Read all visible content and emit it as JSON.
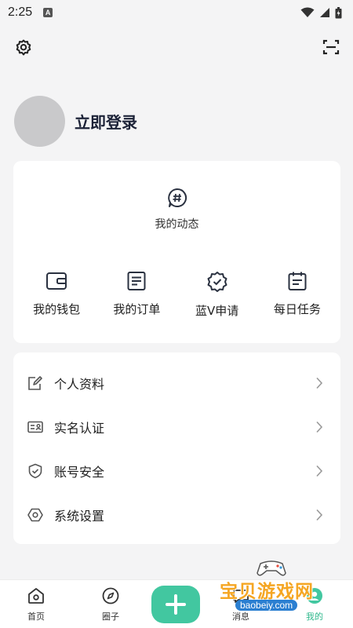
{
  "status_bar": {
    "time": "2:25",
    "badge": "A"
  },
  "profile": {
    "login_label": "立即登录"
  },
  "dynamic": {
    "label": "我的动态"
  },
  "quick_actions": [
    {
      "label": "我的钱包",
      "icon": "wallet-icon"
    },
    {
      "label": "我的订单",
      "icon": "order-list-icon"
    },
    {
      "label": "蓝V申请",
      "icon": "verified-badge-icon"
    },
    {
      "label": "每日任务",
      "icon": "calendar-task-icon"
    }
  ],
  "menu": [
    {
      "label": "个人资料",
      "icon": "edit-profile-icon"
    },
    {
      "label": "实名认证",
      "icon": "id-card-icon"
    },
    {
      "label": "账号安全",
      "icon": "shield-check-icon"
    },
    {
      "label": "系统设置",
      "icon": "settings-hex-icon"
    }
  ],
  "bottom_nav": [
    {
      "label": "首页",
      "icon": "home-icon"
    },
    {
      "label": "圈子",
      "icon": "compass-icon"
    },
    {
      "label": "消息",
      "icon": "message-icon"
    },
    {
      "label": "我的",
      "icon": "profile-icon"
    }
  ],
  "watermark": {
    "text": "宝贝游戏网",
    "url": "baobeiy.com"
  },
  "colors": {
    "accent": "#42c7a0",
    "active_tab": "#2fb88c",
    "background": "#f4f4f5"
  }
}
